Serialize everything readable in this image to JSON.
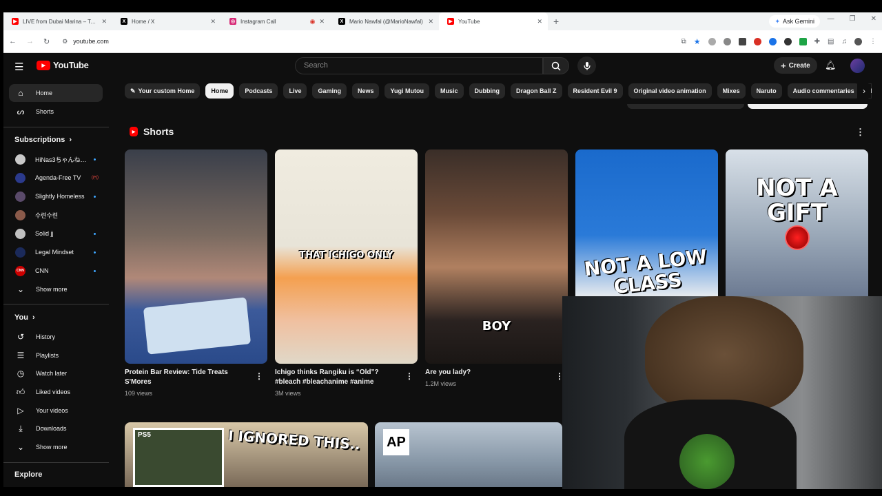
{
  "browser": {
    "tabs": [
      {
        "title": "LIVE from Dubai Marina – Tensi",
        "favicon_color": "#ff0000"
      },
      {
        "title": "Home / X",
        "favicon_color": "#000000"
      },
      {
        "title": "Instagram Call",
        "favicon_color": "#d62976"
      },
      {
        "title": "Mario Nawfal (@MarioNawfal)",
        "favicon_color": "#000000"
      },
      {
        "title": "YouTube",
        "favicon_color": "#ff0000"
      }
    ],
    "gemini_label": "Ask Gemini",
    "url": "youtube.com"
  },
  "header": {
    "logo_text": "YouTube",
    "search_placeholder": "Search",
    "create_label": "Create"
  },
  "sidebar": {
    "main": [
      {
        "label": "Home",
        "icon": "home-icon"
      },
      {
        "label": "Shorts",
        "icon": "shorts-icon"
      }
    ],
    "subscriptions_title": "Subscriptions",
    "subscriptions": [
      {
        "label": "HiNas3ちゃんね…",
        "color": "#c9c9c9",
        "status": "dot"
      },
      {
        "label": "Agenda-Free TV",
        "color": "#2b3a8c",
        "status": "live"
      },
      {
        "label": "Slightly Homeless",
        "color": "#5a4a6a",
        "status": "dot"
      },
      {
        "label": "수련수련",
        "color": "#8a5a4a",
        "status": "none"
      },
      {
        "label": "Solid jj",
        "color": "#c0c0c0",
        "status": "dot"
      },
      {
        "label": "Legal Mindset",
        "color": "#1b2a5a",
        "status": "dot"
      },
      {
        "label": "CNN",
        "color": "#cc0000",
        "status": "dot"
      }
    ],
    "show_more_1": "Show more",
    "you_title": "You",
    "you_items": [
      {
        "label": "History",
        "icon": "history-icon"
      },
      {
        "label": "Playlists",
        "icon": "playlists-icon"
      },
      {
        "label": "Watch later",
        "icon": "watch-later-icon"
      },
      {
        "label": "Liked videos",
        "icon": "like-icon"
      },
      {
        "label": "Your videos",
        "icon": "your-videos-icon"
      },
      {
        "label": "Downloads",
        "icon": "download-icon"
      }
    ],
    "show_more_2": "Show more",
    "explore_title": "Explore"
  },
  "chips": [
    "Your custom Home",
    "Home",
    "Podcasts",
    "Live",
    "Gaming",
    "News",
    "Yugi Mutou",
    "Music",
    "Dubbing",
    "Dragon Ball Z",
    "Resident Evil 9",
    "Original video animation",
    "Mixes",
    "Naruto",
    "Audio commentaries",
    "E"
  ],
  "shorts": {
    "section_title": "Shorts",
    "items": [
      {
        "title": "Protein Bar Review: Tide Treats S'Mores",
        "views": "109 views",
        "overlay": "",
        "bg": "linear-gradient(180deg,#3a3f4a 0%,#7a6a60 40%,#b08878 60%,#3c5a9a 75%,#2a4a8a 100%)"
      },
      {
        "title": "Ichigo thinks Rangiku is “Old”? #bleach #bleachanime #anime",
        "views": "3M views",
        "overlay": "THAT ICHIGO ONLY",
        "bg": "linear-gradient(180deg,#f0ece0 0%,#e8e4d8 45%,#f4a050 60%,#f0c0a0 80%,#e0d8c8 100%)"
      },
      {
        "title": "Are you lady?",
        "views": "1.2M views",
        "overlay": "BOY",
        "bg": "linear-gradient(180deg,#3a2e28 0%,#6a4a38 30%,#b08060 55%,#2a2220 80%,#1a1614 100%)"
      },
      {
        "title": "",
        "views": "",
        "overlay": "NOT A LOW CLASS",
        "bg": "linear-gradient(180deg,#1a6acc 0%,#2a7ad8 40%,#f0f0f0 70%,#e0e0e0 100%)"
      },
      {
        "title": "",
        "views": "",
        "overlay": "NOT A GIFT",
        "bg": "linear-gradient(180deg,#d8e0e8 0%,#9aa8b8 40%,#6a7890 70%,#2a3850 100%)"
      }
    ]
  },
  "row2": [
    {
      "overlay": "I IGNORED THIS..",
      "badge": "PS5"
    },
    {
      "overlay": "",
      "badge": "AP"
    }
  ]
}
